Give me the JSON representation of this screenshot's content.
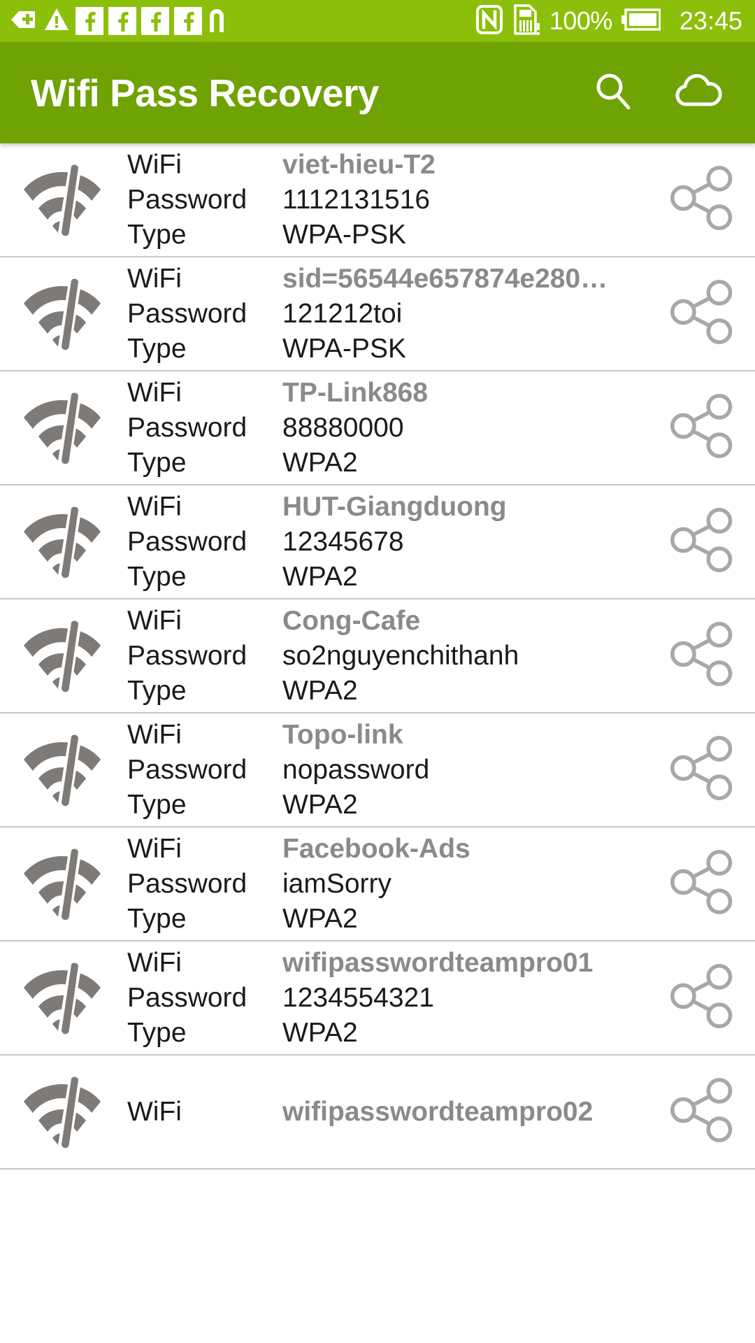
{
  "statusbar": {
    "icons_left": [
      "back-plus-icon",
      "warning-triangle-icon",
      "facebook-icon",
      "facebook-icon",
      "facebook-icon",
      "facebook-icon",
      "n-icon"
    ],
    "icons_right": [
      "nfc-icon",
      "sdcard-warning-icon",
      "battery-icon"
    ],
    "battery_percent": "100%",
    "clock": "23:45",
    "bg_color": "#8cbf09",
    "fg_color": "#ffffff"
  },
  "appbar": {
    "title": "Wifi Pass Recovery",
    "search_label": "search-icon",
    "cloud_label": "cloud-icon",
    "bg_color": "#6fa203",
    "fg_color": "#ffffff"
  },
  "labels": {
    "wifi": "WiFi",
    "password": "Password",
    "type": "Type"
  },
  "colors": {
    "ssid": "#8a8a8a",
    "value": "#1a1a1a",
    "divider": "#c8c8c8",
    "wifi_icon": "#7d7a77",
    "share_icon": "#a8a8a8"
  },
  "networks": [
    {
      "ssid": "viet-hieu-T2",
      "password": "1112131516",
      "type": "WPA-PSK"
    },
    {
      "ssid": "sid=56544e657874e280…",
      "password": "121212toi",
      "type": "WPA-PSK"
    },
    {
      "ssid": "TP-Link868",
      "password": "88880000",
      "type": "WPA2"
    },
    {
      "ssid": "HUT-Giangduong",
      "password": "12345678",
      "type": "WPA2"
    },
    {
      "ssid": "Cong-Cafe",
      "password": "so2nguyenchithanh",
      "type": "WPA2"
    },
    {
      "ssid": "Topo-link",
      "password": "nopassword",
      "type": "WPA2"
    },
    {
      "ssid": "Facebook-Ads",
      "password": "iamSorry",
      "type": "WPA2"
    },
    {
      "ssid": "wifipasswordteampro01",
      "password": "1234554321",
      "type": "WPA2"
    },
    {
      "ssid": "wifipasswordteampro02",
      "password": "",
      "type": ""
    }
  ]
}
